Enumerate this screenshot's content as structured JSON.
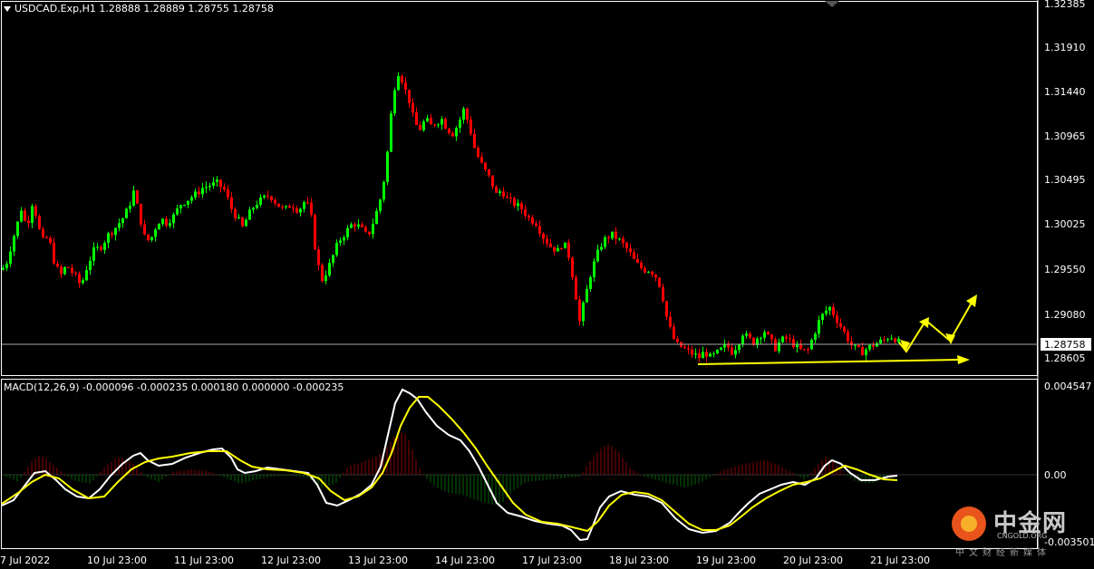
{
  "header": {
    "symbol_line": "USDCAD.Exp,H1  1.28888 1.28889 1.28755 1.28758"
  },
  "macd": {
    "label": "MACD(12,26,9) -0.000096 -0.000235 0.000180 0.000000 -0.000235",
    "axis_labels": [
      "0.004547",
      "0.00",
      "-0.003501"
    ]
  },
  "price_axis": {
    "labels": [
      "1.32385",
      "1.31910",
      "1.31440",
      "1.30965",
      "1.30495",
      "1.30025",
      "1.29550",
      "1.29080",
      "1.28605"
    ],
    "current_price": "1.28758"
  },
  "time_axis": {
    "labels": [
      "7 Jul 2022",
      "10 Jul 23:00",
      "11 Jul 23:00",
      "12 Jul 23:00",
      "13 Jul 23:00",
      "14 Jul 23:00",
      "17 Jul 23:00",
      "18 Jul 23:00",
      "19 Jul 23:00",
      "20 Jul 23:00",
      "21 Jul 23:00"
    ]
  },
  "watermark": {
    "name": "中金网",
    "domain": "CNGOLD.ORG",
    "subtitle": "中文财经新媒体"
  },
  "colors": {
    "bull": "#00ff00",
    "bear": "#ff0000",
    "macd_main": "#ffffff",
    "macd_signal": "#ffff00",
    "hist_pos": "#8b0000",
    "hist_neg": "#006400",
    "annotation": "#ffff00"
  },
  "chart_data": {
    "type": "candlestick",
    "symbol": "USDCAD.Exp",
    "timeframe": "H1",
    "ylim": [
      1.2845,
      1.3238
    ],
    "close_path": [
      [
        0,
        1.2955
      ],
      [
        5,
        1.296
      ],
      [
        12,
        1.2985
      ],
      [
        18,
        1.3005
      ],
      [
        22,
        1.302
      ],
      [
        28,
        1.3
      ],
      [
        35,
        1.303
      ],
      [
        40,
        1.3005
      ],
      [
        45,
        1.2985
      ],
      [
        52,
        1.299
      ],
      [
        58,
        1.2965
      ],
      [
        65,
        1.2948
      ],
      [
        72,
        1.296
      ],
      [
        80,
        1.295
      ],
      [
        88,
        1.2938
      ],
      [
        95,
        1.296
      ],
      [
        102,
        1.2975
      ],
      [
        110,
        1.298
      ],
      [
        118,
        1.2992
      ],
      [
        126,
        1.3
      ],
      [
        134,
        1.301
      ],
      [
        140,
        1.302
      ],
      [
        146,
        1.3038
      ],
      [
        152,
        1.3015
      ],
      [
        158,
        1.299
      ],
      [
        164,
        1.2985
      ],
      [
        170,
        1.3
      ],
      [
        176,
        1.301
      ],
      [
        182,
        1.3005
      ],
      [
        190,
        1.3012
      ],
      [
        198,
        1.3025
      ],
      [
        206,
        1.303
      ],
      [
        214,
        1.3035
      ],
      [
        222,
        1.3042
      ],
      [
        230,
        1.3045
      ],
      [
        238,
        1.3047
      ],
      [
        246,
        1.304
      ],
      [
        254,
        1.302
      ],
      [
        260,
        1.301
      ],
      [
        266,
        1.3
      ],
      [
        272,
        1.3012
      ],
      [
        280,
        1.3025
      ],
      [
        288,
        1.303
      ],
      [
        296,
        1.3035
      ],
      [
        304,
        1.3025
      ],
      [
        312,
        1.3018
      ],
      [
        320,
        1.3025
      ],
      [
        328,
        1.3018
      ],
      [
        336,
        1.303
      ],
      [
        342,
        1.301
      ],
      [
        348,
        1.2965
      ],
      [
        354,
        1.2945
      ],
      [
        360,
        1.2955
      ],
      [
        366,
        1.297
      ],
      [
        372,
        1.2985
      ],
      [
        380,
        1.2995
      ],
      [
        388,
        1.3005
      ],
      [
        396,
        1.3
      ],
      [
        404,
        1.299
      ],
      [
        412,
        1.301
      ],
      [
        418,
        1.303
      ],
      [
        424,
        1.306
      ],
      [
        430,
        1.312
      ],
      [
        436,
        1.3165
      ],
      [
        440,
        1.3165
      ],
      [
        444,
        1.315
      ],
      [
        450,
        1.3135
      ],
      [
        456,
        1.311
      ],
      [
        462,
        1.3105
      ],
      [
        468,
        1.3115
      ],
      [
        474,
        1.3108
      ],
      [
        480,
        1.3112
      ],
      [
        486,
        1.3115
      ],
      [
        492,
        1.3105
      ],
      [
        498,
        1.31
      ],
      [
        504,
        1.311
      ],
      [
        510,
        1.3125
      ],
      [
        516,
        1.311
      ],
      [
        522,
        1.3085
      ],
      [
        528,
        1.307
      ],
      [
        534,
        1.306
      ],
      [
        540,
        1.305
      ],
      [
        546,
        1.3035
      ],
      [
        552,
        1.304
      ],
      [
        558,
        1.303
      ],
      [
        566,
        1.3025
      ],
      [
        574,
        1.302
      ],
      [
        582,
        1.301
      ],
      [
        590,
        1.3005
      ],
      [
        598,
        1.299
      ],
      [
        606,
        1.298
      ],
      [
        614,
        1.2975
      ],
      [
        620,
        1.2985
      ],
      [
        626,
        1.297
      ],
      [
        632,
        1.294
      ],
      [
        638,
        1.29
      ],
      [
        644,
        1.2925
      ],
      [
        650,
        1.295
      ],
      [
        656,
        1.2968
      ],
      [
        662,
        1.2982
      ],
      [
        668,
        1.299
      ],
      [
        674,
        1.2992
      ],
      [
        680,
        1.2988
      ],
      [
        686,
        1.2982
      ],
      [
        692,
        1.2975
      ],
      [
        698,
        1.2965
      ],
      [
        704,
        1.2958
      ],
      [
        710,
        1.2955
      ],
      [
        716,
        1.2955
      ],
      [
        722,
        1.2948
      ],
      [
        728,
        1.2935
      ],
      [
        734,
        1.2905
      ],
      [
        740,
        1.2885
      ],
      [
        746,
        1.2875
      ],
      [
        752,
        1.2872
      ],
      [
        758,
        1.2868
      ],
      [
        764,
        1.2865
      ],
      [
        770,
        1.2862
      ],
      [
        776,
        1.2868
      ],
      [
        782,
        1.2862
      ],
      [
        788,
        1.2865
      ],
      [
        794,
        1.287
      ],
      [
        800,
        1.2875
      ],
      [
        806,
        1.2868
      ],
      [
        812,
        1.2875
      ],
      [
        818,
        1.2888
      ],
      [
        824,
        1.2882
      ],
      [
        830,
        1.2878
      ],
      [
        836,
        1.2885
      ],
      [
        842,
        1.289
      ],
      [
        848,
        1.288
      ],
      [
        854,
        1.2872
      ],
      [
        860,
        1.288
      ],
      [
        866,
        1.2882
      ],
      [
        872,
        1.2878
      ],
      [
        878,
        1.2872
      ],
      [
        884,
        1.2868
      ],
      [
        890,
        1.287
      ],
      [
        896,
        1.2885
      ],
      [
        902,
        1.29
      ],
      [
        908,
        1.291
      ],
      [
        914,
        1.2915
      ],
      [
        920,
        1.2905
      ],
      [
        926,
        1.2895
      ],
      [
        932,
        1.2885
      ],
      [
        938,
        1.2875
      ],
      [
        944,
        1.287
      ],
      [
        950,
        1.2868
      ],
      [
        956,
        1.2872
      ],
      [
        962,
        1.2875
      ],
      [
        968,
        1.2878
      ],
      [
        974,
        1.288
      ],
      [
        980,
        1.2885
      ],
      [
        986,
        1.2882
      ],
      [
        992,
        1.2876
      ]
    ]
  }
}
